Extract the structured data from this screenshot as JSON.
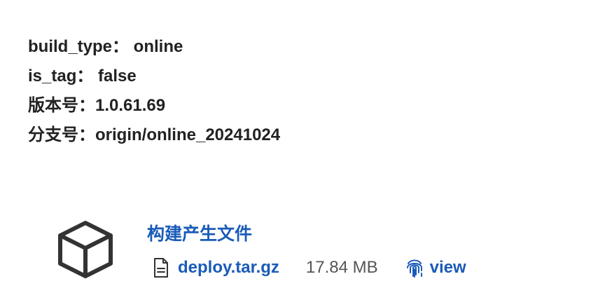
{
  "params": [
    {
      "text": "build_type： online"
    },
    {
      "text": "is_tag： false"
    },
    {
      "text": "版本号：1.0.61.69"
    },
    {
      "text": "分支号：origin/online_20241024"
    }
  ],
  "artifacts": {
    "title": "构建产生文件",
    "file_name": "deploy.tar.gz",
    "file_size": "17.84 MB",
    "view_label": "view"
  },
  "icons": {
    "artifact": "cube-icon",
    "file": "file-icon",
    "view": "fingerprint-icon"
  },
  "colors": {
    "link": "#1a5bb8",
    "text": "#222222",
    "muted": "#555555",
    "icon": "#333333"
  }
}
